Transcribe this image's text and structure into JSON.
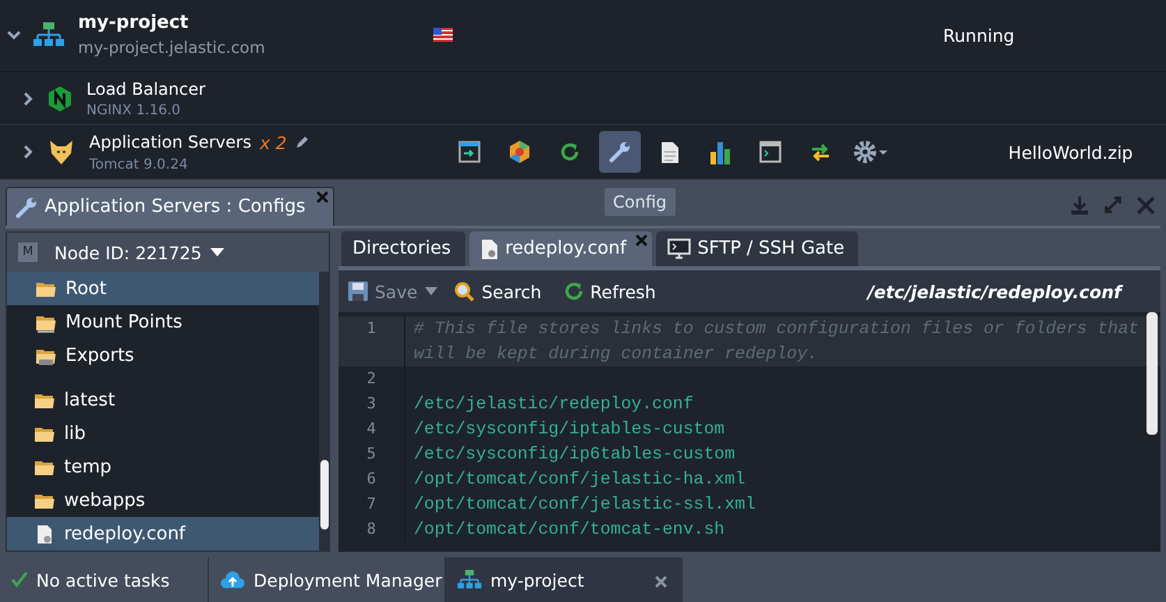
{
  "environment": {
    "name": "my-project",
    "domain": "my-project.jelastic.com",
    "status": "Running",
    "expanded": true
  },
  "nodes": [
    {
      "kind": "balancer",
      "name": "Load Balancer",
      "version": "NGINX 1.16.0",
      "expanded": false
    },
    {
      "kind": "appserver",
      "name": "Application Servers",
      "count": "x 2",
      "version": "Tomcat 9.0.24",
      "expanded": false,
      "deployed": "HelloWorld.zip"
    }
  ],
  "tools": [
    {
      "kind": "open",
      "selected": false
    },
    {
      "kind": "addons",
      "selected": false
    },
    {
      "kind": "restart",
      "selected": false
    },
    {
      "kind": "config",
      "selected": true
    },
    {
      "kind": "log",
      "selected": false
    },
    {
      "kind": "stats",
      "selected": false
    },
    {
      "kind": "terminal",
      "selected": false
    },
    {
      "kind": "redeploy",
      "selected": false
    },
    {
      "kind": "settings",
      "selected": false
    }
  ],
  "tooltip": "Config",
  "panel": {
    "title": "Application Servers : Configs",
    "node": "Node ID: 221725",
    "node_badge": "M"
  },
  "tree": [
    {
      "kind": "folder",
      "label": "Root",
      "selected": true
    },
    {
      "kind": "mount",
      "label": "Mount Points",
      "selected": false
    },
    {
      "kind": "exports",
      "label": "Exports",
      "selected": false
    },
    {
      "kind": "gap"
    },
    {
      "kind": "folder",
      "label": "latest",
      "selected": false
    },
    {
      "kind": "folder",
      "label": "lib",
      "selected": false
    },
    {
      "kind": "folder",
      "label": "temp",
      "selected": false
    },
    {
      "kind": "folder",
      "label": "webapps",
      "selected": false
    },
    {
      "kind": "file",
      "label": "redeploy.conf",
      "selected": true
    }
  ],
  "tabs": [
    {
      "kind": "plain",
      "label": "Directories",
      "selected": false
    },
    {
      "kind": "file",
      "label": "redeploy.conf",
      "selected": true,
      "closable": true
    },
    {
      "kind": "terminal",
      "label": "SFTP / SSH Gate",
      "selected": false
    }
  ],
  "toolbar": {
    "save": "Save",
    "save_disabled": true,
    "search": "Search",
    "refresh": "Refresh",
    "path": "/etc/jelastic/redeploy.conf"
  },
  "lines": [
    {
      "number": "1",
      "kind": "comment",
      "text": "# This file stores links to custom configuration files or folders that will be kept during container redeploy.",
      "current": true
    },
    {
      "number": "2",
      "kind": "code",
      "current": false
    },
    {
      "number": "3",
      "kind": "code",
      "text": "/etc/jelastic/redeploy.conf",
      "current": false
    },
    {
      "number": "4",
      "kind": "code",
      "text": "/etc/sysconfig/iptables-custom",
      "current": false
    },
    {
      "number": "5",
      "kind": "code",
      "text": "/etc/sysconfig/ip6tables-custom",
      "current": false
    },
    {
      "number": "6",
      "kind": "code",
      "text": "/opt/tomcat/conf/jelastic-ha.xml",
      "current": false
    },
    {
      "number": "7",
      "kind": "code",
      "text": "/opt/tomcat/conf/jelastic-ssl.xml",
      "current": false
    },
    {
      "number": "8",
      "kind": "code",
      "text": "/opt/tomcat/conf/tomcat-env.sh",
      "current": false
    }
  ],
  "taskbar": [
    {
      "kind": "tasks",
      "label": "No active tasks",
      "selected": false
    },
    {
      "kind": "deploy",
      "label": "Deployment Manager",
      "selected": false
    },
    {
      "kind": "env",
      "label": "my-project",
      "selected": true,
      "closable": true
    }
  ]
}
